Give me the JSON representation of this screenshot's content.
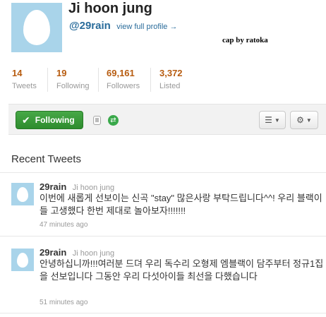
{
  "profile": {
    "display_name": "Ji hoon jung",
    "handle": "@29rain",
    "view_profile_link": "view full profile →",
    "caption": "cap by ratoka"
  },
  "stats": [
    {
      "value": "14",
      "label": "Tweets"
    },
    {
      "value": "19",
      "label": "Following"
    },
    {
      "value": "69,161",
      "label": "Followers"
    },
    {
      "value": "3,372",
      "label": "Listed"
    }
  ],
  "actions": {
    "following_label": "Following",
    "check_icon": "check-icon",
    "device_icon": "phone-icon",
    "retweets_icon": "retweet-icon",
    "list_icon": "list-icon",
    "settings_icon": "gear-icon"
  },
  "colors": {
    "following_button": "#2e8c2e",
    "stat_number": "#b75c10",
    "link": "#2a6c9b",
    "avatar_bg": "#a9d4ea"
  },
  "timeline": {
    "title": "Recent Tweets",
    "tweets": [
      {
        "handle": "29rain",
        "name": "Ji hoon jung",
        "text": "이번에 새롭게 선보이는 신곡 \"stay\" 많은사랑 부탁드립니다^^! 우리 블랙이들 고생했다 한번 제대로 놀아보자!!!!!!!",
        "time": "47 minutes ago"
      },
      {
        "handle": "29rain",
        "name": "Ji hoon jung",
        "text": "안녕하십니까!!!여러분 드뎌 우리 독수리 오형제 엠블랙이 담주부터 정규1집을 선보입니다 그동안 우리 다섯아이들 최선을 다했습니다",
        "time": "51 minutes ago"
      }
    ]
  }
}
